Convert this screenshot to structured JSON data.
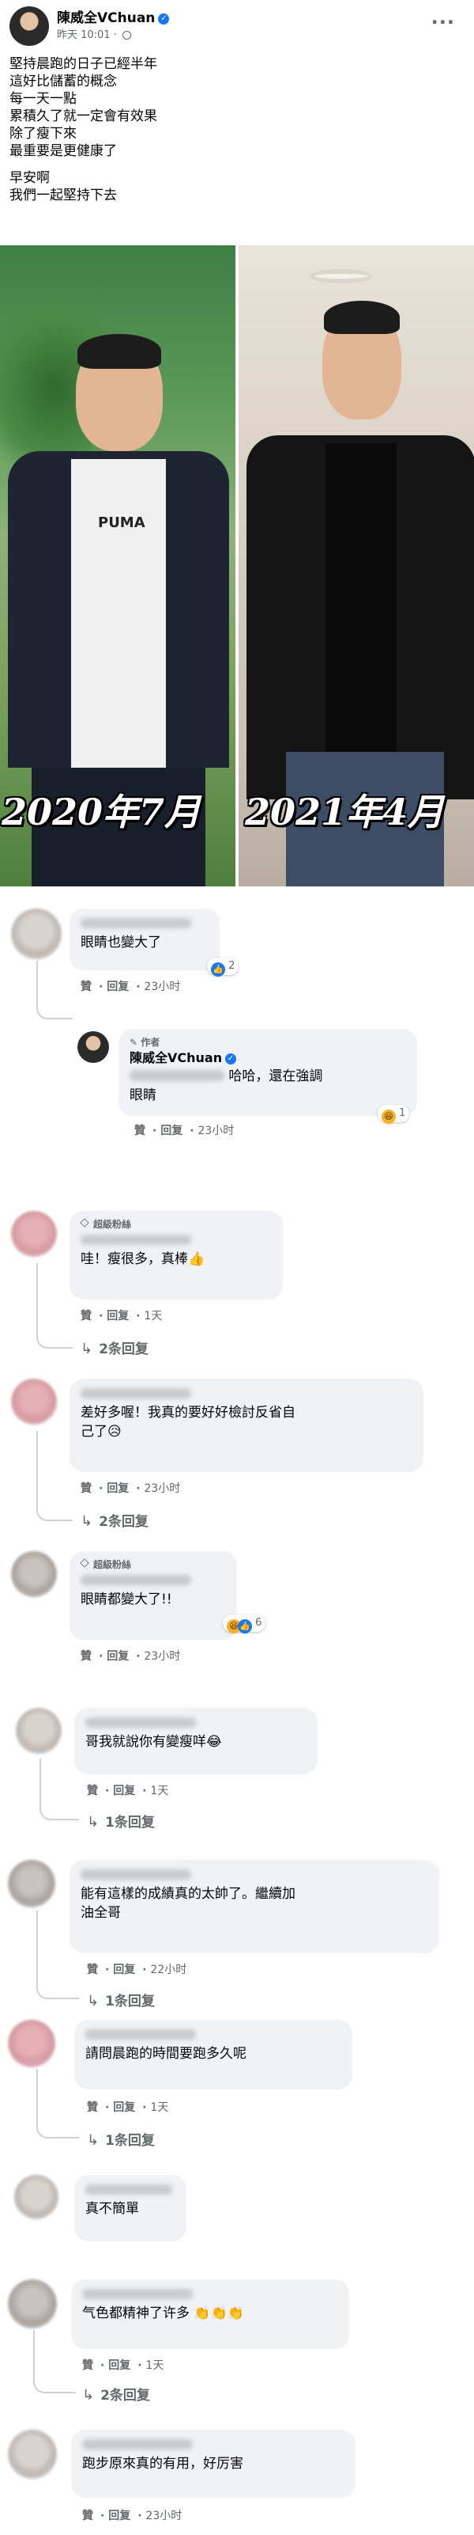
{
  "post": {
    "author": "陳威全VChuan",
    "time": "昨天 10:01",
    "privacy_icon": "globe-icon",
    "more_icon": "more-options-icon",
    "text_lines": [
      "堅持晨跑的日子已經半年",
      "這好比儲蓄的概念",
      "每一天一點",
      "累積久了就一定會有效果",
      "除了瘦下來",
      "最重要是更健康了",
      "",
      "早安啊",
      "我們一起堅持下去"
    ],
    "photo": {
      "left_caption": "2020年7月",
      "right_caption": "2021年4月",
      "shirt_brand": "PUMA"
    }
  },
  "labels": {
    "like": "贊",
    "reply": "回复"
  },
  "comments": [
    {
      "text": "眼睛也變大了",
      "time": "23小时",
      "reaction_count": "2"
    },
    {
      "reply": {
        "tag": "作者",
        "name": "陳威全VChuan",
        "text_line1": "哈哈，還在強調",
        "text_line2": "眼睛",
        "time": "23小时",
        "reaction_count": "1"
      }
    },
    {
      "badge": "超級粉絲",
      "text": "哇！瘦很多，真棒👍",
      "time": "1天",
      "replies": "2条回复"
    },
    {
      "text_line1": "差好多喔！我真的要好好檢討反省自",
      "text_line2": "己了😥",
      "time": "23小时",
      "replies": "2条回复"
    },
    {
      "badge": "超級粉絲",
      "text": "眼睛都變大了!!",
      "time": "23小时",
      "reaction_count": "6"
    },
    {
      "text": "哥我就說你有變瘦咩😂",
      "time": "1天",
      "replies": "1条回复"
    },
    {
      "text_line1": "能有這樣的成績真的太帥了。繼續加",
      "text_line2": "油全哥",
      "time": "22小时",
      "replies": "1条回复"
    },
    {
      "text": "請問晨跑的時間要跑多久呢",
      "time": "1天",
      "replies": "1条回复"
    },
    {
      "text": "真不簡單"
    },
    {
      "text": "气色都精神了许多 👏👏👏",
      "time": "1天",
      "replies": "2条回复"
    },
    {
      "text": "跑步原來真的有用，好厉害",
      "time": "23小时"
    }
  ]
}
